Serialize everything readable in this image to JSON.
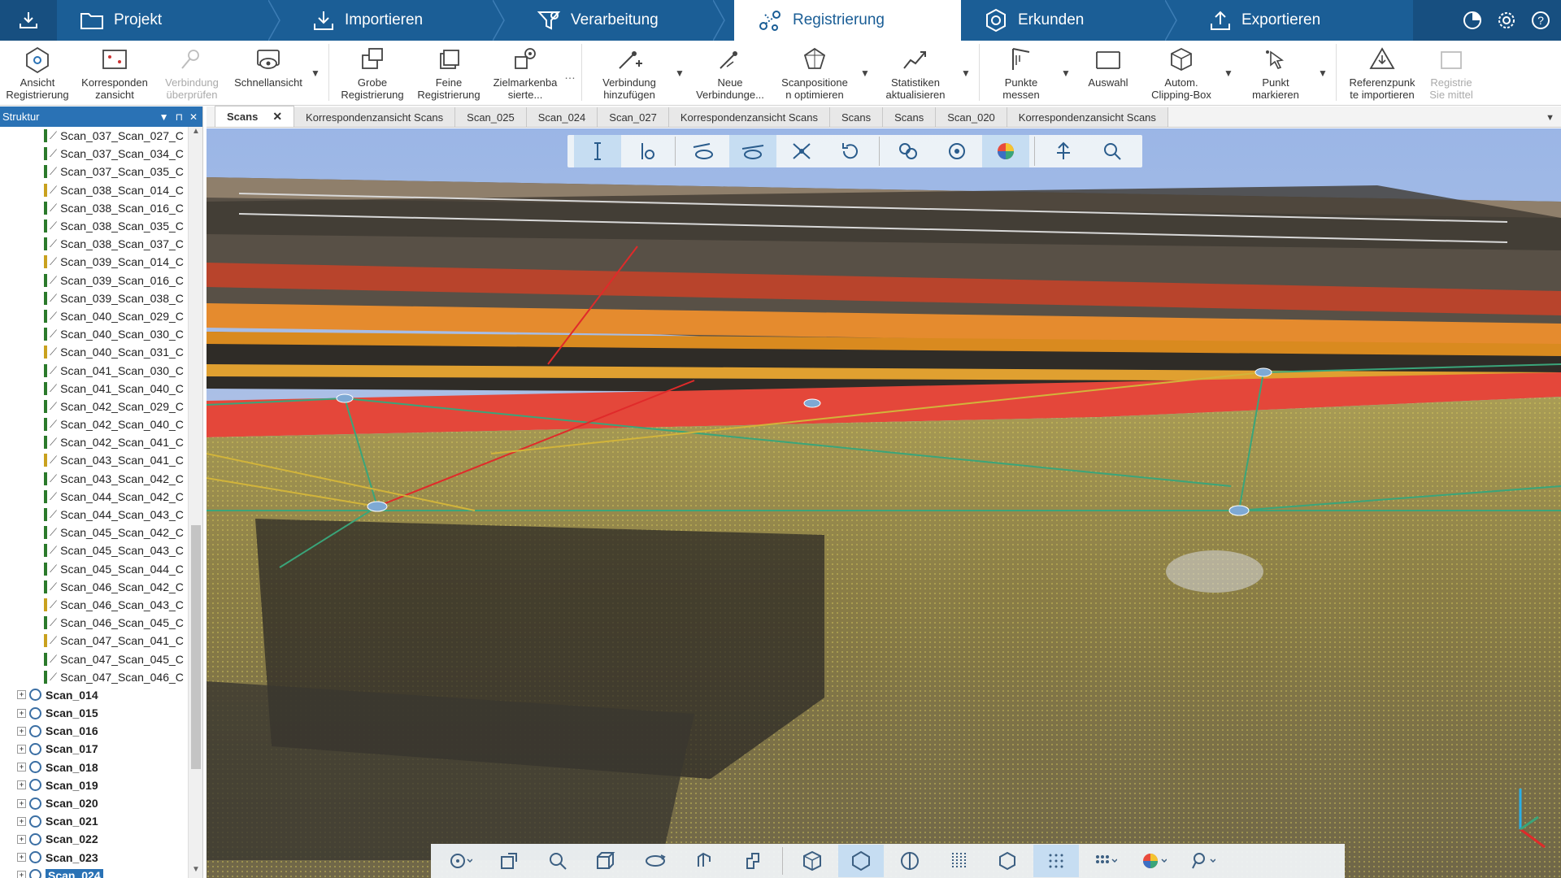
{
  "workflow": {
    "steps": [
      {
        "label": "Projekt",
        "icon": "folder-icon"
      },
      {
        "label": "Importieren",
        "icon": "import-icon"
      },
      {
        "label": "Verarbeitung",
        "icon": "processing-icon"
      },
      {
        "label": "Registrierung",
        "icon": "registration-icon",
        "active": true
      },
      {
        "label": "Erkunden",
        "icon": "explore-icon"
      },
      {
        "label": "Exportieren",
        "icon": "export-icon"
      }
    ],
    "right_icons": [
      "progress-icon",
      "settings-icon",
      "help-icon"
    ],
    "colors": {
      "bar": "#1b5e96",
      "active_text": "#1b5e96"
    }
  },
  "ribbon": {
    "buttons": [
      {
        "line1": "Ansicht",
        "line2": "Registrierung"
      },
      {
        "line1": "Korresponden",
        "line2": "zansicht"
      },
      {
        "line1": "Verbindung",
        "line2": "überprüfen",
        "disabled": true
      },
      {
        "line1": "Schnellansicht",
        "line2": ""
      },
      {
        "line1": "Grobe",
        "line2": "Registrierung"
      },
      {
        "line1": "Feine",
        "line2": "Registrierung"
      },
      {
        "line1": "Zielmarkenba",
        "line2": "sierte..."
      },
      {
        "line1": "Verbindung",
        "line2": "hinzufügen"
      },
      {
        "line1": "Neue",
        "line2": "Verbindunge..."
      },
      {
        "line1": "Scanpositione",
        "line2": "n optimieren"
      },
      {
        "line1": "Statistiken",
        "line2": "aktualisieren"
      },
      {
        "line1": "Punkte",
        "line2": "messen"
      },
      {
        "line1": "Auswahl",
        "line2": ""
      },
      {
        "line1": "Autom.",
        "line2": "Clipping-Box"
      },
      {
        "line1": "Punkt",
        "line2": "markieren"
      },
      {
        "line1": "Referenzpunk",
        "line2": "te importieren"
      },
      {
        "line1": "Registrie",
        "line2": "Sie mittel",
        "disabled": true
      }
    ]
  },
  "panel": {
    "title": "Struktur",
    "links": [
      "Scan_037_Scan_027_C",
      "Scan_037_Scan_034_C",
      "Scan_037_Scan_035_C",
      "Scan_038_Scan_014_C",
      "Scan_038_Scan_016_C",
      "Scan_038_Scan_035_C",
      "Scan_038_Scan_037_C",
      "Scan_039_Scan_014_C",
      "Scan_039_Scan_016_C",
      "Scan_039_Scan_038_C",
      "Scan_040_Scan_029_C",
      "Scan_040_Scan_030_C",
      "Scan_040_Scan_031_C",
      "Scan_041_Scan_030_C",
      "Scan_041_Scan_040_C",
      "Scan_042_Scan_029_C",
      "Scan_042_Scan_040_C",
      "Scan_042_Scan_041_C",
      "Scan_043_Scan_041_C",
      "Scan_043_Scan_042_C",
      "Scan_044_Scan_042_C",
      "Scan_044_Scan_043_C",
      "Scan_045_Scan_042_C",
      "Scan_045_Scan_043_C",
      "Scan_045_Scan_044_C",
      "Scan_046_Scan_042_C",
      "Scan_046_Scan_043_C",
      "Scan_046_Scan_045_C",
      "Scan_047_Scan_041_C",
      "Scan_047_Scan_045_C",
      "Scan_047_Scan_046_C"
    ],
    "scans": [
      "Scan_014",
      "Scan_015",
      "Scan_016",
      "Scan_017",
      "Scan_018",
      "Scan_019",
      "Scan_020",
      "Scan_021",
      "Scan_022",
      "Scan_023",
      "Scan_024"
    ],
    "selected_scan": "Scan_024"
  },
  "tabs": [
    {
      "label": "Scans",
      "active": true,
      "closable": true
    },
    {
      "label": "Korrespondenzansicht Scans"
    },
    {
      "label": "Scan_025"
    },
    {
      "label": "Scan_024"
    },
    {
      "label": "Scan_027"
    },
    {
      "label": "Korrespondenzansicht Scans"
    },
    {
      "label": "Scans"
    },
    {
      "label": "Scans"
    },
    {
      "label": "Scan_020"
    },
    {
      "label": "Korrespondenzansicht Scans"
    }
  ],
  "viewport_toolbar": [
    "measure-icon",
    "point-info-icon",
    "view-connection-icon",
    "hide-connection-icon",
    "split-icon",
    "rotate-icon",
    "cluster-icon",
    "refresh-cluster-icon",
    "color-icon",
    "up-icon",
    "zoom-fit-icon"
  ],
  "bottom_toolbar": [
    "orbit-icon",
    "home-view-icon",
    "zoom-icon",
    "cube-view-icon",
    "rotate-view-icon",
    "walk-icon",
    "fly-icon",
    "scene-cube-icon",
    "clipping-icon",
    "section-icon",
    "grid-icon",
    "box-icon",
    "points-icon",
    "density-icon",
    "color-mode-icon",
    "measure-tool-icon"
  ],
  "accent": "#2a72b5"
}
